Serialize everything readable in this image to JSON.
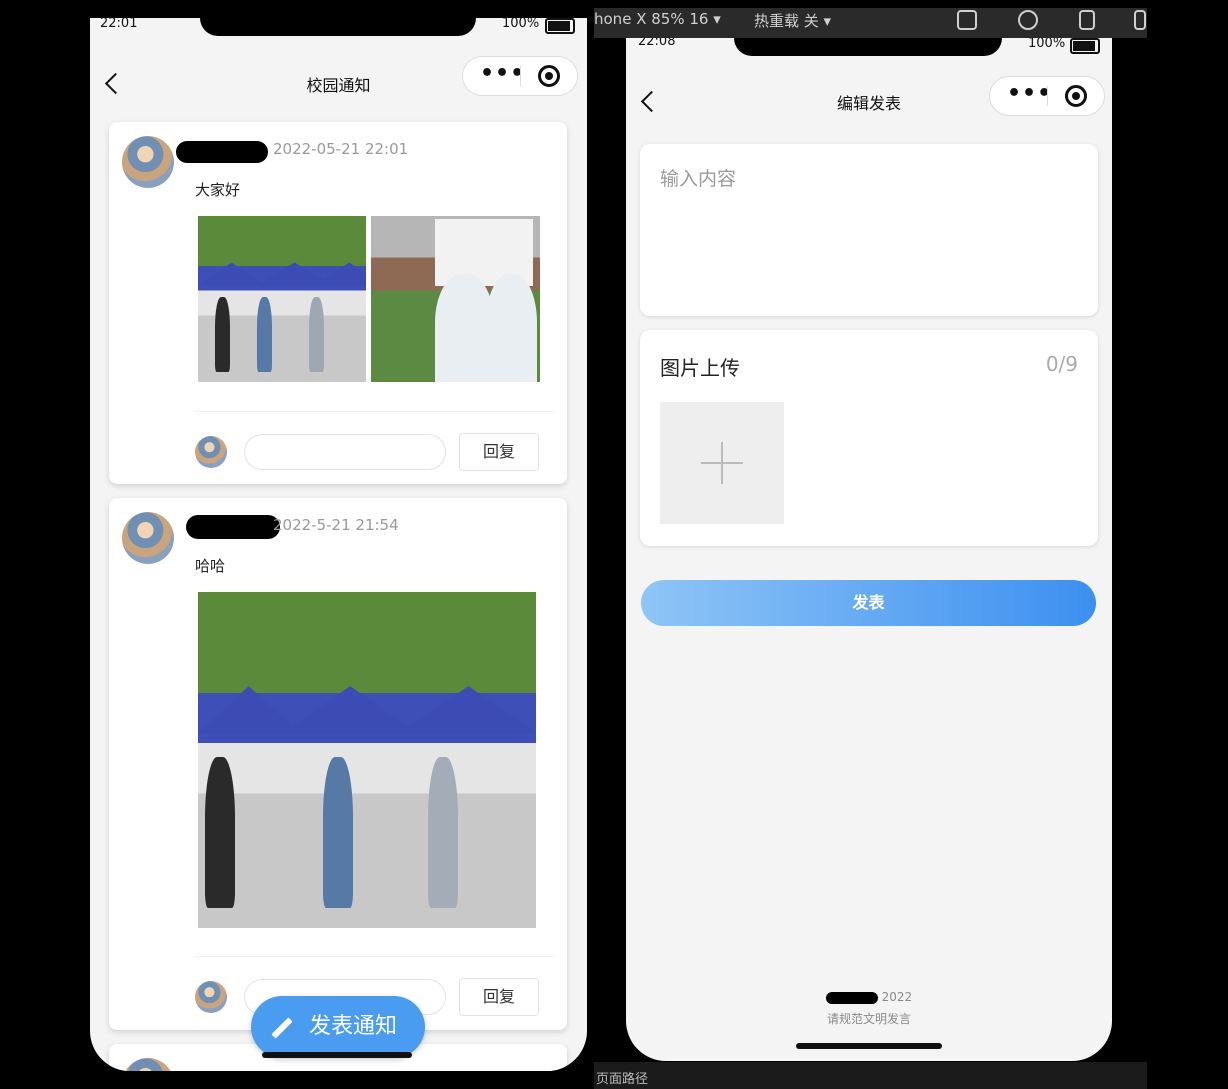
{
  "ide": {
    "device": "hone X 85% 16 ▾",
    "network": "热重载 关 ▾",
    "bottom_text": "页面路径"
  },
  "left": {
    "status_time": "22:01",
    "battery": "100%",
    "title": "校园通知",
    "posts": [
      {
        "time": "2022-05-21 22:01",
        "text": "大家好",
        "reply": "回复"
      },
      {
        "time": "2022-5-21 21:54",
        "text": "哈哈",
        "reply": "回复"
      }
    ],
    "fab_label": "发表通知"
  },
  "right": {
    "status_time": "22:08",
    "battery": "100%",
    "title": "编辑发表",
    "content_placeholder": "输入内容",
    "upload_title": "图片上传",
    "upload_count": "0/9",
    "publish_label": "发表",
    "footer_year": "2022",
    "footer_note": "请规范文明发言"
  },
  "colors": {
    "accent": "#4a9cf0",
    "gradient_start": "#8fc5f6",
    "gradient_end": "#3c8ff0"
  }
}
